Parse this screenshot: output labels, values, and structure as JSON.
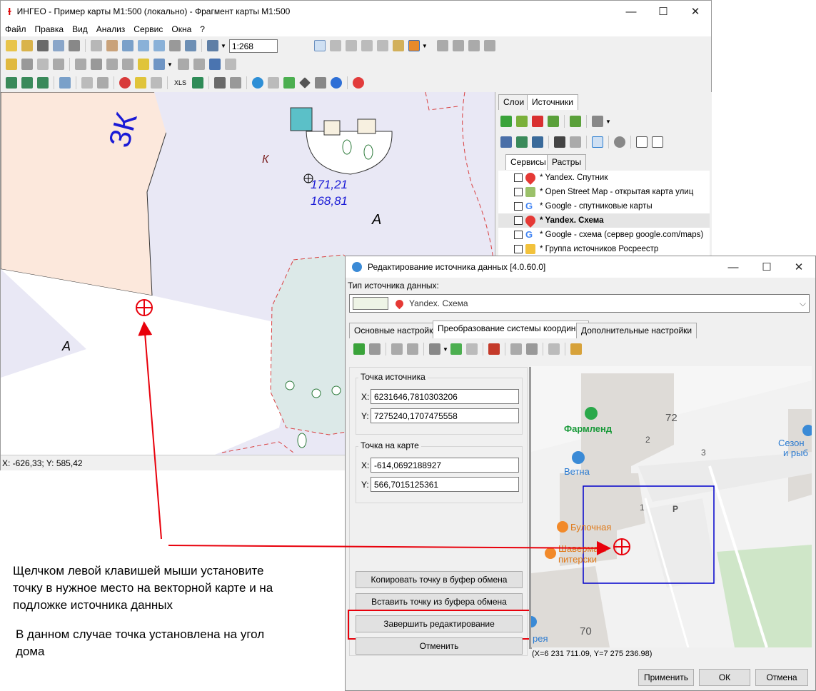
{
  "main_window": {
    "title": "ИНГЕО - Пример карты М1:500 (локально) - Фрагмент карты М1:500",
    "menu": [
      "Файл",
      "Правка",
      "Вид",
      "Анализ",
      "Сервис",
      "Окна",
      "?"
    ],
    "scale_value": "1:268",
    "status": "X: -626,33; Y: 585,42"
  },
  "map": {
    "label_3k": "3К",
    "label_k": "К",
    "coord1": "171,21",
    "coord2": "168,81",
    "label_a1": "А",
    "label_a2": "А"
  },
  "layers_panel": {
    "tabs": [
      "Слои",
      "Источники"
    ],
    "subtabs": [
      "Сервисы",
      "Растры"
    ],
    "items": [
      {
        "label": "* Yandex. Спутник",
        "selected": false
      },
      {
        "label": "* Open Street Map - открытая карта улиц",
        "selected": false
      },
      {
        "label": "* Google - спутниковые карты",
        "selected": false
      },
      {
        "label": "* Yandex. Схема",
        "selected": true
      },
      {
        "label": "* Google - схема (сервер google.com/maps)",
        "selected": false
      },
      {
        "label": "* Группа источников Росреестр",
        "selected": false
      }
    ]
  },
  "dialog": {
    "title": "Редактирование источника данных [4.0.60.0]",
    "type_label": "Тип источника данных:",
    "type_value": "Yandex. Схема",
    "tabs": [
      "Основные настройки",
      "Преобразование системы координат",
      "Дополнительные настройки"
    ],
    "source_point": {
      "title": "Точка источника",
      "x_label": "X:",
      "x_value": "6231646,7810303206",
      "y_label": "Y:",
      "y_value": "7275240,1707475558"
    },
    "map_point": {
      "title": "Точка на карте",
      "x_label": "X:",
      "x_value": "-614,0692188927",
      "y_label": "Y:",
      "y_value": "566,7015125361"
    },
    "buttons": {
      "copy": "Копировать точку в буфер обмена",
      "paste": "Вставить точку из буфера обмена",
      "finish": "Завершить редактирование",
      "cancel_edit": "Отменить",
      "apply": "Применить",
      "ok": "ОК",
      "cancel": "Отмена"
    },
    "tile_map": {
      "b72": "72",
      "pharmacy": "Фармленд",
      "e2": "2",
      "e3": "3",
      "vet": "Ветна",
      "season1": "Сезон",
      "season2": "и рыб",
      "e1": "1",
      "parking": "Р",
      "bakery": "Булочная",
      "shawarma1": "Шаверма п",
      "shawarma2": "питерски",
      "b70": "70",
      "orea": "рея"
    },
    "coords": "(X=6 231 711.09, Y=7 275 236.98)"
  },
  "annotation": {
    "line1": "Щелчком левой клавишей мыши установите",
    "line2": "точку в нужное место на векторной карте и на",
    "line3": "подложке источника данных",
    "line4": "В данном случае точка установлена на угол",
    "line5": "дома"
  },
  "colors": {
    "accent_red": "#e8000b",
    "frame_blue": "#0000cc",
    "label_blue": "#1a1ad6"
  }
}
